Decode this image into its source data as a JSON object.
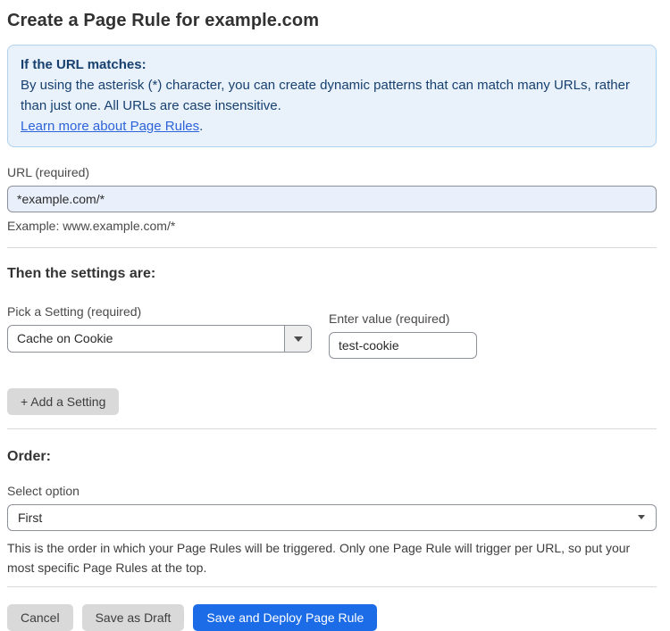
{
  "page": {
    "title": "Create a Page Rule for example.com"
  },
  "info_box": {
    "heading": "If the URL matches:",
    "body": "By using the asterisk (*) character, you can create dynamic patterns that can match many URLs, rather than just one. All URLs are case insensitive.",
    "link_label": "Learn more about Page Rules",
    "link_suffix": "."
  },
  "url_field": {
    "label": "URL (required)",
    "value": "*example.com/*",
    "helper": "Example: www.example.com/*"
  },
  "settings_section": {
    "heading": "Then the settings are:",
    "setting_picker": {
      "label": "Pick a Setting (required)",
      "selected": "Cache on Cookie"
    },
    "value_field": {
      "label": "Enter value (required)",
      "value": "test-cookie"
    },
    "add_setting_label": "+ Add a Setting"
  },
  "order_section": {
    "heading": "Order:",
    "select_label": "Select option",
    "selected_option": "First",
    "helper": "This is the order in which your Page Rules will be triggered. Only one Page Rule will trigger per URL, so put your most specific Page Rules at the top."
  },
  "actions": {
    "cancel": "Cancel",
    "save_draft": "Save as Draft",
    "save_deploy": "Save and Deploy Page Rule"
  },
  "colors": {
    "accent_blue": "#1c6ce8",
    "info_bg": "#e9f2fb",
    "info_border": "#b0d1ee",
    "info_text": "#17406f",
    "link_blue": "#2d63d9",
    "url_input_bg": "#e9f0fb",
    "button_gray": "#d9d9d9"
  }
}
